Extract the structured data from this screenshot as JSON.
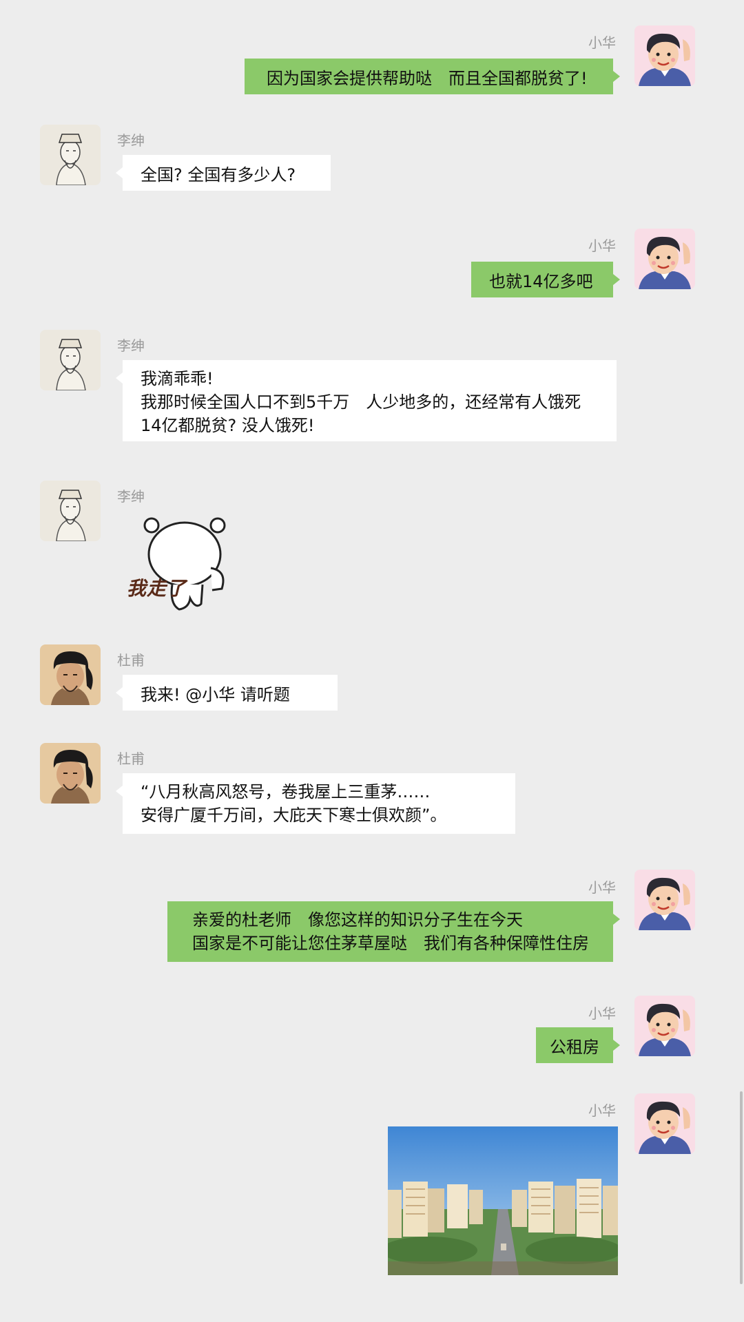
{
  "contacts": {
    "xiaohua": "小华",
    "lishen": "李绅",
    "dufu": "杜甫"
  },
  "messages": [
    {
      "sender": "xiaohua",
      "name": "小华",
      "lines": [
        "因为国家会提供帮助哒　而且全国都脱贫了!"
      ]
    },
    {
      "sender": "lishen",
      "name": "李绅",
      "lines": [
        "全国? 全国有多少人?"
      ]
    },
    {
      "sender": "xiaohua",
      "name": "小华",
      "lines": [
        "也就14亿多吧"
      ]
    },
    {
      "sender": "lishen",
      "name": "李绅",
      "lines": [
        "我滴乖乖!",
        "我那时候全国人口不到5千万　人少地多的，还经常有人饿死",
        "14亿都脱贫? 没人饿死!"
      ]
    },
    {
      "sender": "lishen",
      "name": "李绅",
      "sticker_text": "我走了"
    },
    {
      "sender": "dufu",
      "name": "杜甫",
      "lines": [
        "我来! @小华 请听题"
      ]
    },
    {
      "sender": "dufu",
      "name": "杜甫",
      "lines": [
        "“八月秋高风怒号，卷我屋上三重茅……",
        "安得广厦千万间，大庇天下寒士俱欢颜”。"
      ]
    },
    {
      "sender": "xiaohua",
      "name": "小华",
      "lines": [
        "亲爱的杜老师　像您这样的知识分子生在今天",
        "国家是不可能让您住茅草屋哒　我们有各种保障性住房"
      ]
    },
    {
      "sender": "xiaohua",
      "name": "小华",
      "lines": [
        "公租房"
      ]
    },
    {
      "sender": "xiaohua",
      "name": "小华",
      "image": "apartment-complex-photo"
    }
  ],
  "colors": {
    "background": "#ededed",
    "outgoing_bubble": "#8bc969",
    "incoming_bubble": "#ffffff",
    "name_text": "#9a9a9a"
  }
}
